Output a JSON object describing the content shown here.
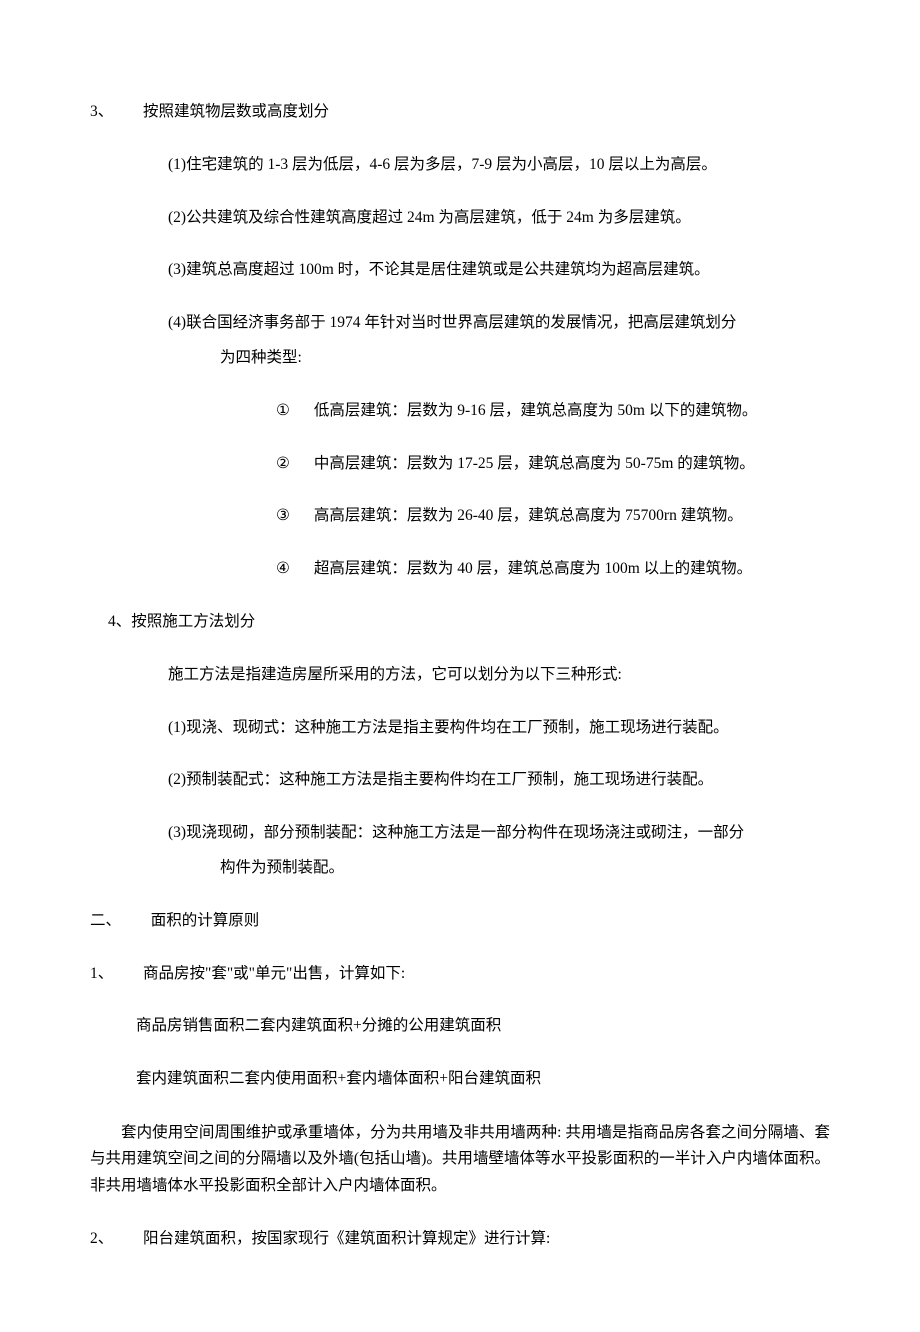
{
  "s3": {
    "num": "3、",
    "title": "按照建筑物层数或高度划分",
    "items": [
      "(1)住宅建筑的 1-3 层为低层，4-6 层为多层，7-9 层为小高层，10 层以上为高层。",
      "(2)公共建筑及综合性建筑高度超过 24m 为高层建筑，低于 24m 为多层建筑。",
      "(3)建筑总高度超过 100m 时，不论其是居住建筑或是公共建筑均为超高层建筑。"
    ],
    "item4_a": "(4)联合国经济事务部于 1974 年针对当时世界高层建筑的发展情况，把高层建筑划分",
    "item4_b": "为四种类型:",
    "circ": [
      {
        "n": "①",
        "t": "低高层建筑：层数为 9-16 层，建筑总高度为 50m 以下的建筑物。"
      },
      {
        "n": "②",
        "t": "中高层建筑：层数为 17-25 层，建筑总高度为 50-75m 的建筑物。"
      },
      {
        "n": "③",
        "t": "高高层建筑：层数为 26-40 层，建筑总高度为 75700rn 建筑物。"
      },
      {
        "n": "④",
        "t": "超高层建筑：层数为 40 层，建筑总高度为 100m 以上的建筑物。"
      }
    ]
  },
  "s4": {
    "head": "4、按照施工方法划分",
    "intro": "施工方法是指建造房屋所采用的方法，它可以划分为以下三种形式:",
    "l1": "(1)现浇、现砌式：这种施工方法是指主要构件均在工厂预制，施工现场进行装配。",
    "l2": "(2)预制装配式：这种施工方法是指主要构件均在工厂预制，施工现场进行装配。",
    "l3a": "(3)现浇现砌，部分预制装配：这种施工方法是一部分构件在现场浇注或砌注，一部分",
    "l3b": "构件为预制装配。"
  },
  "p2": {
    "num": "二、",
    "title": "面积的计算原则",
    "i1num": "1、",
    "i1title": "商品房按\"套\"或\"单元\"出售，计算如下:",
    "i1_line1": "商品房销售面积二套内建筑面积+分摊的公用建筑面积",
    "i1_line2": "套内建筑面积二套内使用面积+套内墙体面积+阳台建筑面积",
    "para": "套内使用空间周围维护或承重墙体，分为共用墙及非共用墙两种: 共用墙是指商品房各套之间分隔墙、套与共用建筑空间之间的分隔墙以及外墙(包括山墙)。共用墙壁墙体等水平投影面积的一半计入户内墙体面积。非共用墙墙体水平投影面积全部计入户内墙体面积。",
    "i2num": "2、",
    "i2title": "阳台建筑面积，按国家现行《建筑面积计算规定》进行计算:"
  }
}
